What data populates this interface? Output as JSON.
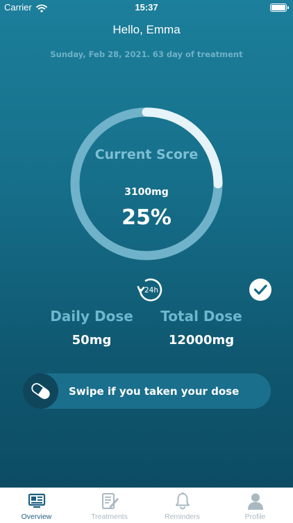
{
  "status_bar": {
    "carrier": "Carrier",
    "time": "15:37"
  },
  "header": {
    "greeting": "Hello, Emma",
    "date_line": "Sunday, Feb 28, 2021. 63 day of treatment"
  },
  "score": {
    "title": "Current Score",
    "amount": "3100mg",
    "percent_label": "25%",
    "progress_fraction": 0.25
  },
  "doses": {
    "daily": {
      "icon": "clock-24h-icon",
      "badge": "24h",
      "label": "Daily Dose",
      "value": "50mg"
    },
    "total": {
      "icon": "check-circle-icon",
      "label": "Total Dose",
      "value": "12000mg"
    }
  },
  "swipe": {
    "icon": "pill-icon",
    "label": "Swipe if you taken your dose"
  },
  "tabs": [
    {
      "label": "Overview",
      "icon": "overview-icon",
      "active": true
    },
    {
      "label": "Treatments",
      "icon": "treatments-icon",
      "active": false
    },
    {
      "label": "Reminders",
      "icon": "bell-icon",
      "active": false
    },
    {
      "label": "Profile",
      "icon": "profile-icon",
      "active": false
    }
  ],
  "colors": {
    "background_top": "#1c7f9b",
    "background_bottom": "#0b4a61",
    "ring_track": "#6fb2c9",
    "ring_progress": "#e6f3f8",
    "accent_label": "#6eb7cd",
    "tab_active": "#1d5f80",
    "tab_inactive": "#a8b9c1"
  }
}
